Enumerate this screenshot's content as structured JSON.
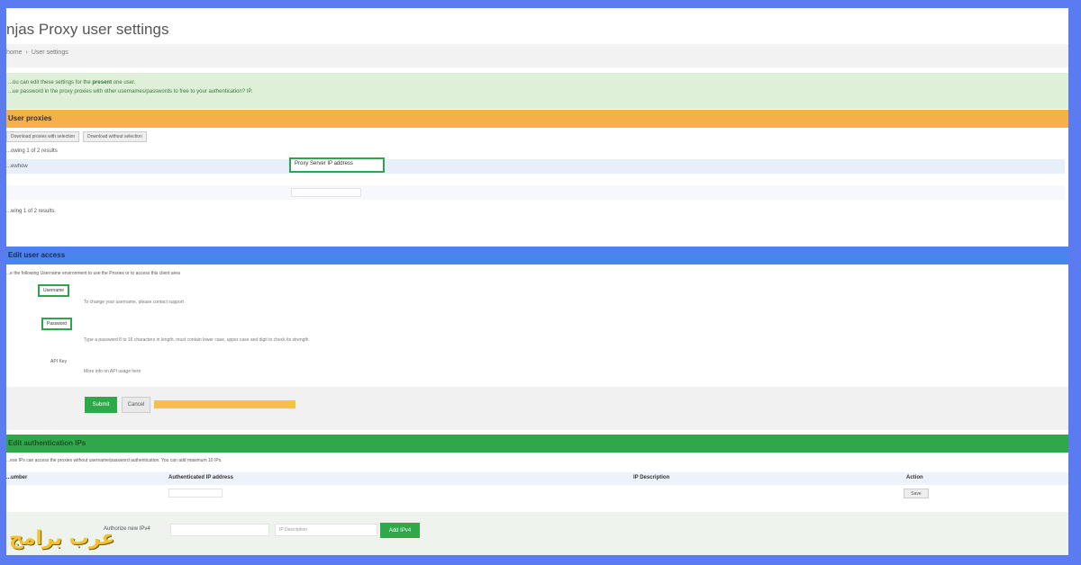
{
  "header": {
    "title": "njas Proxy user settings"
  },
  "breadcrumb": {
    "home": "home",
    "separator": "›",
    "current": "User settings"
  },
  "alert": {
    "line1_pre": "...ou can edit these settings for the ",
    "line1_bold": "present",
    "line1_post": " one user.",
    "line2": "...ue password in the proxy proxies with other usernames/passwords to free to your authentication? IP."
  },
  "proxies_panel": {
    "title": "User proxies",
    "buttons": [
      "Download proxies with selection",
      "Download without selection"
    ],
    "showing_top": "...owing 1 of 2 results",
    "row_label": "...ewhow",
    "ip_field_value": "Proxy Server IP address",
    "showing_bottom": "...wing 1 of 2 results."
  },
  "access_panel": {
    "title": "Edit user access",
    "intro": "...e the following Username environment to use the Proxies or to access this client area",
    "username_label": "Username",
    "username_hint": "To change your username, please contact support",
    "password_label": "Password",
    "password_hint": "Type a password 8 to 16 characters in length, must contain lower case, upper case and digit to check its strength",
    "api_label": "API Key",
    "api_hint": "More info on API usage here",
    "submit_label": "Submit",
    "cancel_label": "Cancel"
  },
  "auth_panel": {
    "title": "Edit authentication IPs",
    "intro": "...ese IPs can access the proxies without username/password authentication. You can add maximum 10 IPs.",
    "columns": [
      "...umber",
      "Authenticated IP address",
      "IP Description",
      "Action"
    ],
    "row_action": "Save",
    "new_ip_label": "Authorize new IPv4",
    "description_placeholder": "IP Description",
    "add_label": "Add IPv4"
  },
  "watermark": "عرب برامج",
  "colors": {
    "border": "#5a7cf0",
    "orange_header": "#f5b04a",
    "blue_header": "#4a84ee",
    "green_header": "#2fa84a",
    "highlight": "#2ea44f"
  }
}
